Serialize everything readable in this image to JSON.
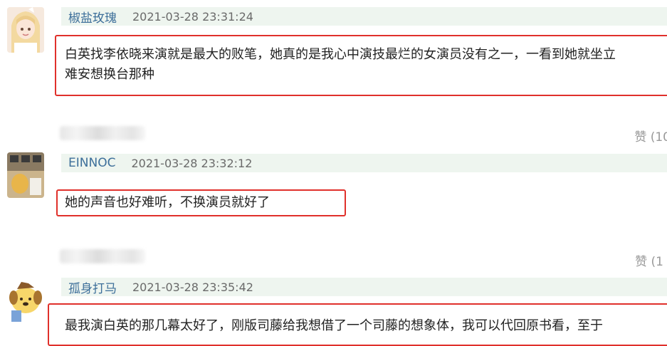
{
  "comments": [
    {
      "username": "椒盐玫瑰",
      "time": "2021-03-28 23:31:24",
      "lines": [
        "白英找李依晓来演就是最大的败笔，她真的是我心中演技最烂的女演员没有之一，一看到她就坐立",
        "难安想换台那种"
      ],
      "like": "赞 (10"
    },
    {
      "username": "EINNOC",
      "time": "2021-03-28 23:32:12",
      "lines": [
        "她的声音也好难听，不换演员就好了"
      ],
      "like": "赞 (1"
    },
    {
      "username": "孤身打马",
      "time": "2021-03-28 23:35:42",
      "lines": [
        "最我演白英的那几幕太好了，刚版司藤给我想借了一个司藤的想象体，我可以代回原书看，至于"
      ]
    }
  ],
  "icons": {
    "avatar_1": "anime-girl-avatar",
    "avatar_2": "photo-room-avatar",
    "avatar_3": "pompompurin-dog-avatar"
  }
}
